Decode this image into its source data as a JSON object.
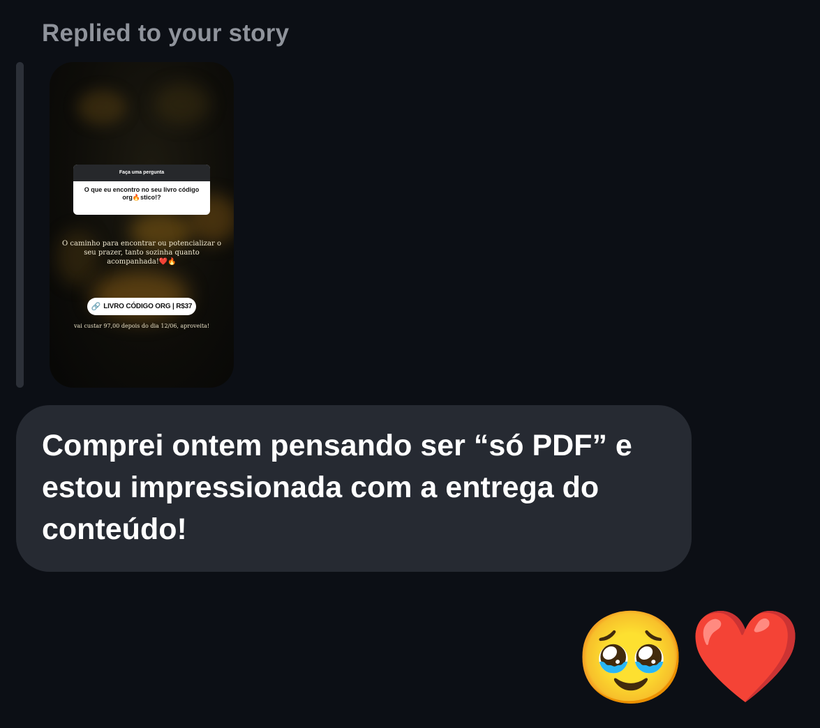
{
  "header": {
    "replied_label": "Replied to your story"
  },
  "story": {
    "question_header": "Faça uma pergunta",
    "question_text": "O que eu encontro no seu livro código org🔥stico!?",
    "caption": "O caminho para encontrar ou potencializar o seu prazer, tanto sozinha quanto acompanhada!❤️🔥",
    "link_sticker_label": "LIVRO CÓDIGO ORG | R$37",
    "link_icon": "link-icon",
    "note": "vai custar 97,00 depois do dia 12/06, aproveita!"
  },
  "message": {
    "text": "Comprei ontem pensando ser “só PDF” e estou impressionada com a entrega do conteúdo!"
  },
  "reactions": {
    "pleading_face": "🥹",
    "heart": "❤️"
  },
  "colors": {
    "background": "#0c0f15",
    "bubble": "#262a32",
    "label": "#8f939b",
    "reply_bar": "#2c3038"
  }
}
